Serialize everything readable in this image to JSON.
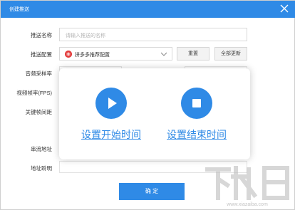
{
  "window": {
    "title": "创建推送"
  },
  "form": {
    "name_label": "推送名称",
    "name_placeholder": "请输入推送的名称",
    "config_label": "推送配置",
    "config_value": "拼多多推荐配置",
    "reset_label": "重置",
    "update_all_label": "全部更新",
    "sample_rate_label": "音频采样率",
    "fps_label": "视频帧率(FPS)",
    "keyframe_label": "关键帧间距",
    "stream_url_label": "串流地址",
    "address_note_label": "地址聆明",
    "confirm_label": "确 定"
  },
  "overlay": {
    "start_label": "设置开始时间",
    "end_label": "设置结束时间"
  },
  "colors": {
    "accent": "#2f8ae6",
    "brand_dot": "#e33b3b"
  },
  "icons": {
    "close": "close-icon",
    "brand": "pdd-logo-icon",
    "dropdown": "chevron-down-icon",
    "play": "play-icon",
    "stop": "stop-icon"
  },
  "watermark": {
    "text": "下载吧",
    "url": "www.xiazaiba.com"
  }
}
